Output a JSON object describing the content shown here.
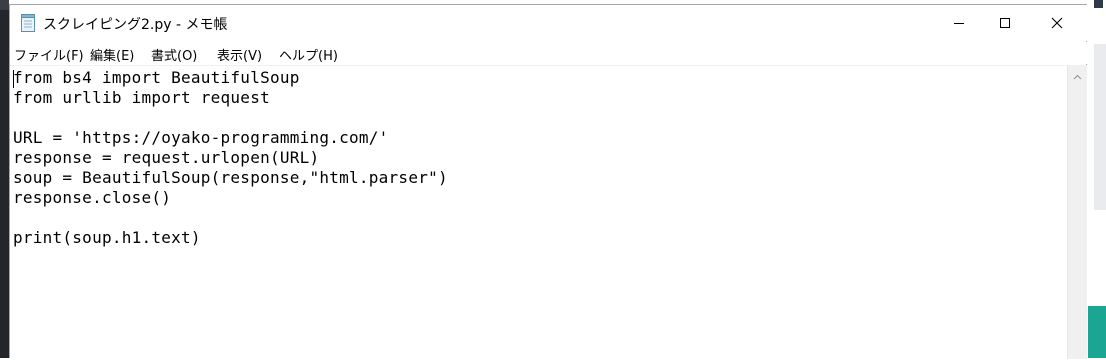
{
  "window": {
    "title": "スクレイピング2.py - メモ帳",
    "app_icon": "notepad-icon",
    "controls": {
      "minimize_icon": "minimize-icon",
      "maximize_icon": "maximize-icon",
      "close_icon": "close-icon"
    }
  },
  "menu": {
    "items": [
      {
        "label": "ファイル(F)"
      },
      {
        "label": "編集(E)"
      },
      {
        "label": "書式(O)"
      },
      {
        "label": "表示(V)"
      },
      {
        "label": "ヘルプ(H)"
      }
    ]
  },
  "editor": {
    "content": "from bs4 import BeautifulSoup\nfrom urllib import request\n\nURL = 'https://oyako-programming.com/'\nresponse = request.urlopen(URL)\nsoup = BeautifulSoup(response,\"html.parser\")\nresponse.close()\n\nprint(soup.h1.text)"
  },
  "scrollbar": {
    "up_icon": "chevron-up-icon"
  },
  "colors": {
    "desktop_left": "#23262b",
    "desktop_accent": "#1aa692",
    "scrollbar": "#f0f0f0"
  }
}
